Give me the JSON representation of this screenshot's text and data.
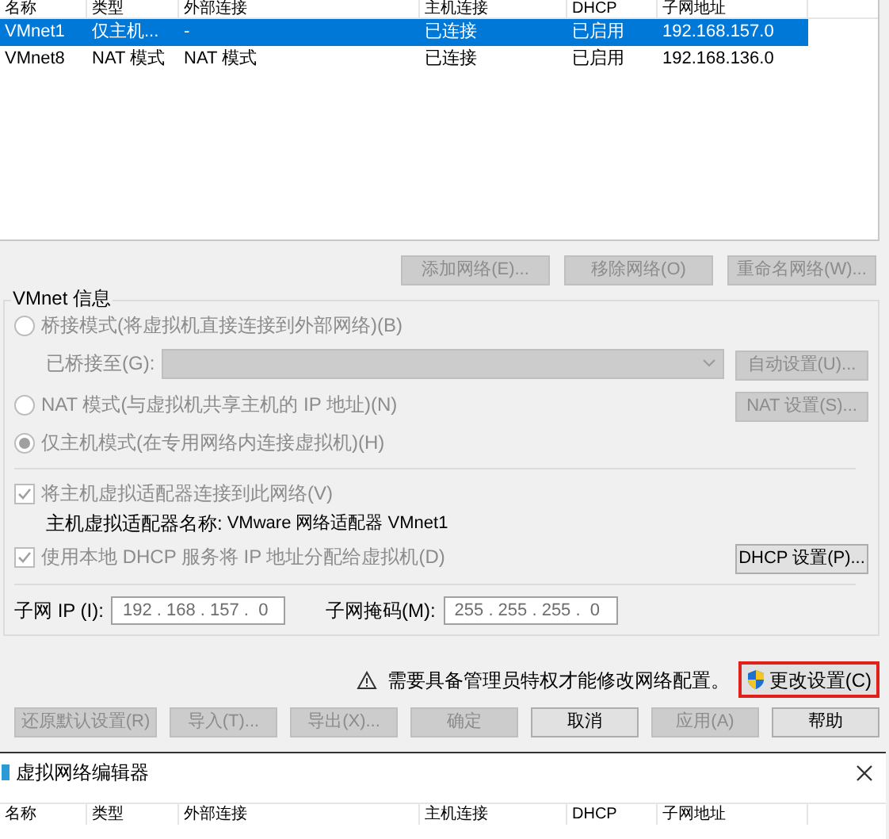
{
  "network_table": {
    "columns": [
      "名称",
      "类型",
      "外部连接",
      "主机连接",
      "DHCP",
      "子网地址"
    ],
    "rows": [
      {
        "cells": [
          "VMnet1",
          "仅主机...",
          "-",
          "已连接",
          "已启用",
          "192.168.157.0"
        ],
        "selected": true
      },
      {
        "cells": [
          "VMnet8",
          "NAT 模式",
          "NAT 模式",
          "已连接",
          "已启用",
          "192.168.136.0"
        ],
        "selected": false
      }
    ]
  },
  "network_buttons": [
    {
      "label": "添加网络(E)...",
      "disabled": true
    },
    {
      "label": "移除网络(O)",
      "disabled": true
    },
    {
      "label": "重命名网络(W)...",
      "disabled": true
    }
  ],
  "vmnet_info": {
    "title": "VMnet 信息",
    "modes": [
      {
        "label": "桥接模式(将虚拟机直接连接到外部网络)(B)",
        "selected": false,
        "disabled": true
      },
      {
        "label": "NAT 模式(与虚拟机共享主机的 IP 地址)(N)",
        "selected": false,
        "disabled": true
      },
      {
        "label": "仅主机模式(在专用网络内连接虚拟机)(H)",
        "selected": true,
        "disabled": true
      }
    ],
    "bridge_to": {
      "label": "已桥接至(G):",
      "disabled": true
    },
    "auto_button": {
      "label": "自动设置(U)...",
      "disabled": true
    },
    "nat_button": {
      "label": "NAT 设置(S)...",
      "disabled": true
    },
    "connect_adapter": {
      "label": "将主机虚拟适配器连接到此网络(V)",
      "checked": true,
      "disabled": true
    },
    "adapter_name": {
      "label": "主机虚拟适配器名称:",
      "value": "VMware 网络适配器 VMnet1"
    },
    "use_dhcp": {
      "label": "使用本地 DHCP 服务将 IP 地址分配给虚拟机(D)",
      "checked": true,
      "disabled": true
    },
    "dhcp_button": {
      "label": "DHCP 设置(P)...",
      "disabled": false
    },
    "subnet_ip": {
      "label": "子网 IP (I):",
      "value": "192 . 168 . 157 .  0"
    },
    "subnet_mask": {
      "label": "子网掩码(M):",
      "value": "255 . 255 . 255 .  0"
    }
  },
  "admin_warning": {
    "text": "需要具备管理员特权才能修改网络配置。",
    "button": "更改设置(C)",
    "highlighted": true
  },
  "dialog_buttons": [
    {
      "label": "还原默认设置(R)",
      "disabled": true
    },
    {
      "label": "导入(T)...",
      "disabled": true
    },
    {
      "label": "导出(X)...",
      "disabled": true
    },
    {
      "label": "确定",
      "disabled": true
    },
    {
      "label": "取消",
      "disabled": false
    },
    {
      "label": "应用(A)",
      "disabled": true
    },
    {
      "label": "帮助",
      "disabled": false
    }
  ],
  "second_window": {
    "title": "虚拟网络编辑器",
    "columns": [
      "名称",
      "类型",
      "外部连接",
      "主机连接",
      "DHCP",
      "子网地址"
    ]
  }
}
